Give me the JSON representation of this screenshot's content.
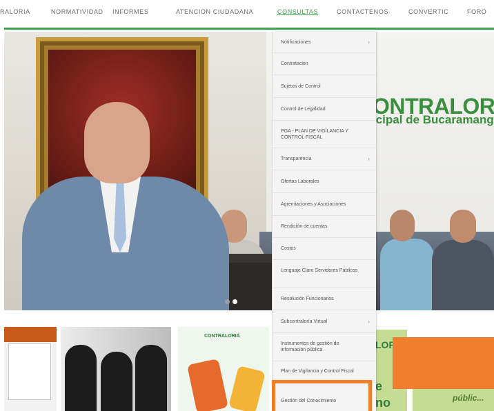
{
  "nav": {
    "items": [
      {
        "label": "RALORIA"
      },
      {
        "label": "NORMATIVIDAD"
      },
      {
        "label": "INFORMES"
      },
      {
        "label": "ATENCION CIUDADANA"
      },
      {
        "label": "CONSULTAS"
      },
      {
        "label": "CONTACTENOS"
      },
      {
        "label": "CONVERTIC"
      },
      {
        "label": "FORO"
      }
    ],
    "active_index": 4,
    "accent_color": "#3aa14b"
  },
  "hero": {
    "brand_line1": "ONTRALORIA",
    "brand_line2": "icipal de Bucaramanga",
    "slides": 2,
    "active_slide": 2
  },
  "menu": {
    "items": [
      {
        "label": "Notificaciones"
      },
      {
        "label": "Contratación"
      },
      {
        "label": "Sujetos de Control"
      },
      {
        "label": "Control de Legalidad"
      },
      {
        "label": "PGA - PLAN DE VIGILANCIA Y CONTROL FISCAL"
      },
      {
        "label": "Transparencia"
      },
      {
        "label": "Ofertas Laborales"
      },
      {
        "label": "Agremiaciones y Asociaciones"
      },
      {
        "label": "Rendición de cuentas"
      },
      {
        "label": "Costos"
      },
      {
        "label": "Lenguaje Claro Servidores Públicos"
      },
      {
        "label": "Resolución Funcionarios"
      },
      {
        "label": "Subcontraloría Virtual"
      },
      {
        "label": "Instrumentos de gestión de información pública"
      },
      {
        "label": "Plan de Vigilancia y Control Fiscal"
      },
      {
        "label": "Gestión del Conocimiento"
      }
    ],
    "chevron": "›",
    "highlight_color": "#ef7f2d"
  },
  "tiles": {
    "t3_logo": "CONTRALORIA",
    "t4_text1": "LOP",
    "t4_text2": "e",
    "t4_text3": "no",
    "t4_text4": "públic..."
  }
}
